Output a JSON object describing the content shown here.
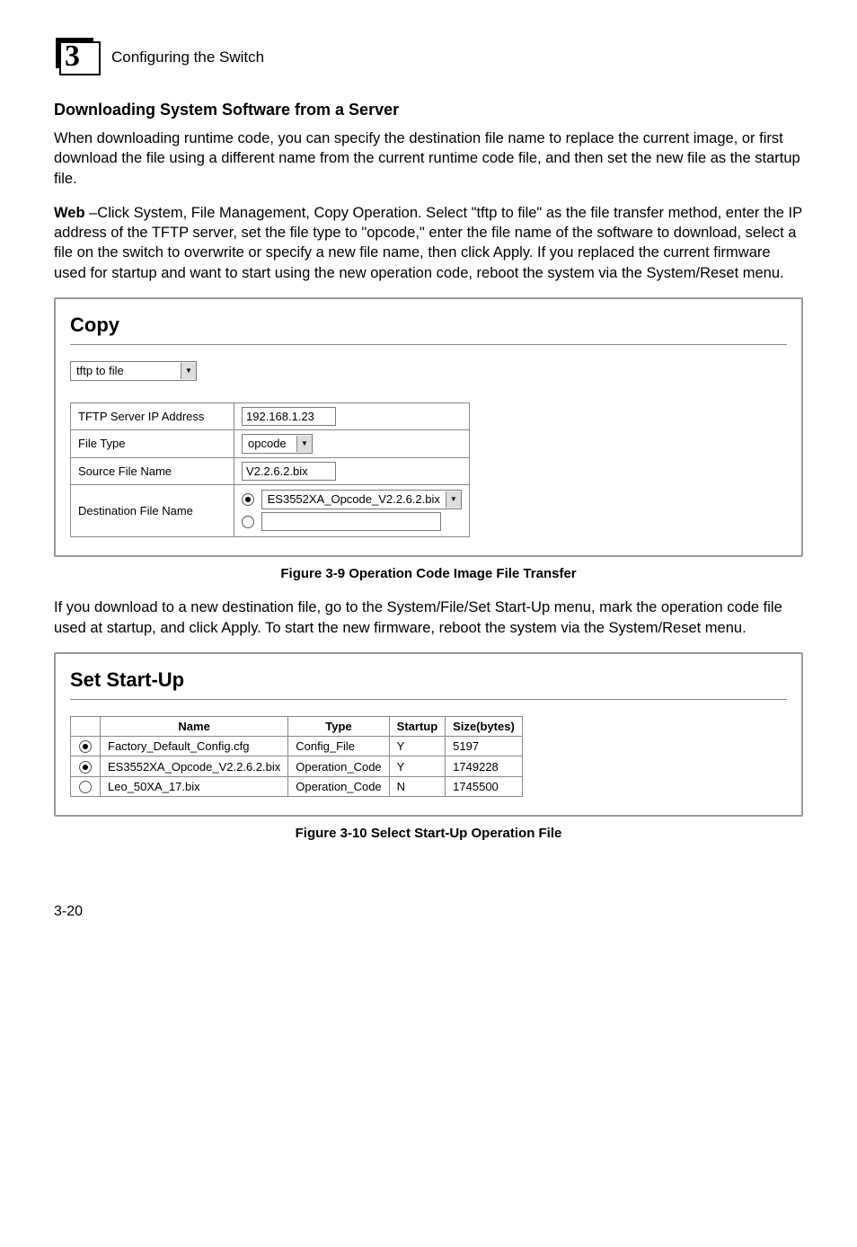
{
  "header": {
    "chapter_number": "3",
    "breadcrumb": "Configuring the Switch"
  },
  "section_heading": "Downloading System Software from a Server",
  "para1": "When downloading runtime code, you can specify the destination file name to replace the current image, or first download the file using a different name from the current runtime code file, and then set the new file as the startup file.",
  "para2_prefix": "Web",
  "para2_rest": " –Click System, File Management, Copy Operation. Select \"tftp to file\" as the file transfer method, enter the IP address of the TFTP server, set the file type to \"opcode,\" enter the file name of the software to download, select a file on the switch to overwrite or specify a new file name, then click Apply. If you replaced the current firmware used for startup and want to start using the new operation code, reboot the system via the System/Reset menu.",
  "copy_card": {
    "title": "Copy",
    "method": "tftp to file",
    "rows": {
      "tftp_label": "TFTP Server IP Address",
      "tftp_value": "192.168.1.23",
      "file_type_label": "File Type",
      "file_type_value": "opcode",
      "source_label": "Source File Name",
      "source_value": "V2.2.6.2.bix",
      "dest_label": "Destination File Name",
      "dest_select_value": "ES3552XA_Opcode_V2.2.6.2.bix"
    }
  },
  "figure1_caption": "Figure 3-9  Operation Code Image File Transfer",
  "para3": "If you download to a new destination file, go to the System/File/Set Start-Up menu, mark the operation code file used at startup, and click Apply. To start the new firmware, reboot the system via the System/Reset menu.",
  "startup_card": {
    "title": "Set Start-Up",
    "headers": {
      "name": "Name",
      "type": "Type",
      "startup": "Startup",
      "size": "Size(bytes)"
    },
    "rows": [
      {
        "selected": true,
        "name": "Factory_Default_Config.cfg",
        "type": "Config_File",
        "startup": "Y",
        "size": "5197"
      },
      {
        "selected": true,
        "name": "ES3552XA_Opcode_V2.2.6.2.bix",
        "type": "Operation_Code",
        "startup": "Y",
        "size": "1749228"
      },
      {
        "selected": false,
        "name": "Leo_50XA_17.bix",
        "type": "Operation_Code",
        "startup": "N",
        "size": "1745500"
      }
    ]
  },
  "figure2_caption": "Figure 3-10  Select Start-Up Operation File",
  "page_number": "3-20"
}
